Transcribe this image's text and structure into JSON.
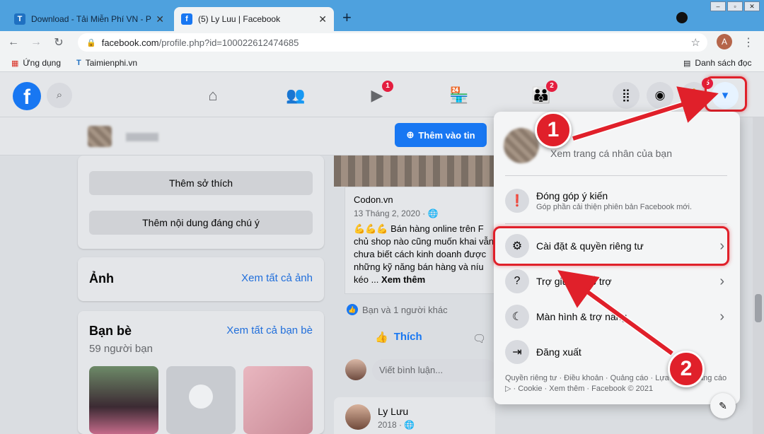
{
  "browser": {
    "tabs": [
      {
        "title": "Download - Tải Miễn Phí VN - Ph",
        "favicon": "T"
      },
      {
        "title": "(5) Ly Luu | Facebook",
        "favicon": "f"
      }
    ],
    "url_host": "facebook.com",
    "url_path": "/profile.php?id=100022612474685",
    "profile_initial": "A",
    "bookmarks": [
      {
        "label": "Ứng dụng"
      },
      {
        "label": "Taimienphi.vn"
      }
    ],
    "reading_list": "Danh sách đọc"
  },
  "facebook": {
    "logo": "f",
    "badges": {
      "watch": "1",
      "groups": "2",
      "notifications": "5"
    },
    "add_story": "Thêm vào tin",
    "left": {
      "hobbies_btn": "Thêm sở thích",
      "featured_btn": "Thêm nội dung đáng chú ý",
      "photos_title": "Ảnh",
      "photos_link": "Xem tất cả ảnh",
      "friends_title": "Bạn bè",
      "friends_link": "Xem tất cả bạn bè",
      "friends_count": "59 người bạn"
    },
    "post": {
      "source": "Codon.vn",
      "date": "13 Tháng 2, 2020 · ",
      "text": "💪💪💪 Bán hàng online trên F chủ shop nào cũng muốn khai vẫn chưa biết cách kinh doanh được những kỹ năng bán hàng và níu kéo ... ",
      "see_more": "Xem thêm",
      "reactions": "Bạn và 1 người khác",
      "like": "Thích",
      "comment_placeholder": "Viết bình luận...",
      "next_author": "Ly Lưu",
      "next_date": "2018 · "
    },
    "menu": {
      "profile_sub": "Xem trang cá nhân của bạn",
      "feedback_title": "Đóng góp ý kiến",
      "feedback_sub": "Góp phần cải thiện phiên bản Facebook mới.",
      "settings": "Cài đặt & quyền riêng tư",
      "help": "Trợ giúp & hỗ trợ",
      "display": "Màn hình & trợ năng",
      "logout": "Đăng xuất",
      "footer": "Quyền riêng tư · Điều khoản · Quảng cáo · Lựa chọn quảng cáo ▷ · Cookie · Xem thêm · Facebook © 2021"
    }
  },
  "annotations": {
    "step1": "1",
    "step2": "2",
    "accent": "#e0202a"
  }
}
